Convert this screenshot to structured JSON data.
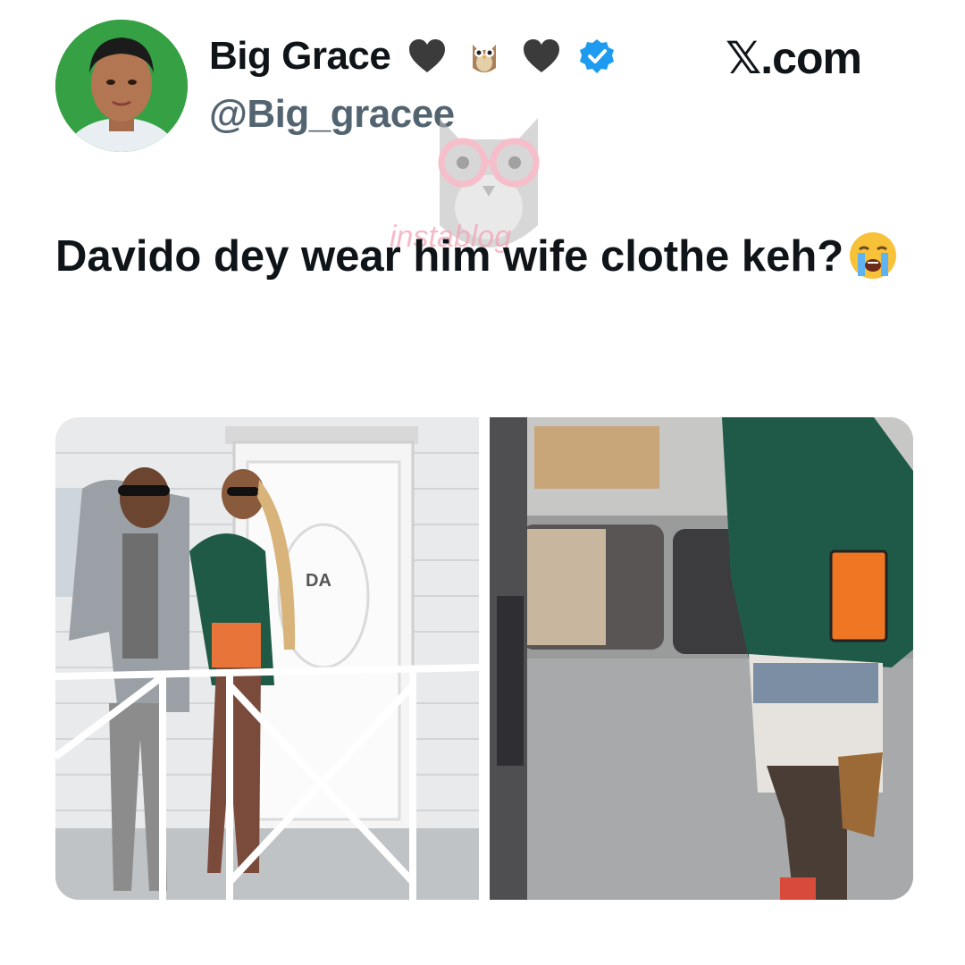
{
  "author": {
    "display_name": "Big Grace",
    "handle": "@Big_gracee",
    "name_emojis": [
      "black-heart-icon",
      "owl-icon",
      "black-heart-icon",
      "verified-badge-icon"
    ]
  },
  "brand": {
    "label": "𝕏.com"
  },
  "watermark": {
    "text": "instablog"
  },
  "tweet": {
    "text": "Davido dey wear him wife clothe keh?",
    "emoji": "loudly-crying-face-icon"
  },
  "media": {
    "photo1": {
      "door_sign": "DA"
    },
    "photo2": {}
  },
  "colors": {
    "verified": "#1d9bf0",
    "handle": "#536471",
    "text": "#0f1419"
  }
}
